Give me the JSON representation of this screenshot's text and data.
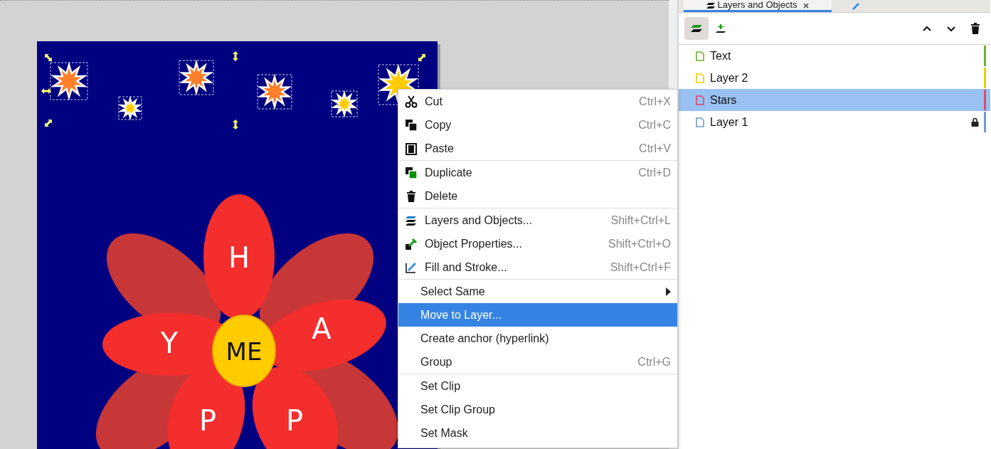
{
  "canvas": {
    "petal_letters": [
      "H",
      "Y",
      "A",
      "P",
      "P"
    ],
    "center_text": "ME"
  },
  "context_menu": {
    "sections": [
      [
        {
          "label": "Cut",
          "shortcut": "Ctrl+X",
          "kind": "icon",
          "selected": false
        },
        {
          "label": "Copy",
          "shortcut": "Ctrl+C",
          "kind": "icon",
          "selected": false
        },
        {
          "label": "Paste",
          "shortcut": "Ctrl+V",
          "kind": "icon",
          "selected": false
        }
      ],
      [
        {
          "label": "Duplicate",
          "shortcut": "Ctrl+D",
          "kind": "icon",
          "selected": false
        },
        {
          "label": "Delete",
          "kind": "icon",
          "selected": false
        }
      ],
      [
        {
          "label": "Layers and Objects...",
          "shortcut": "Shift+Ctrl+L",
          "kind": "icon",
          "selected": false
        },
        {
          "label": "Object Properties...",
          "shortcut": "Shift+Ctrl+O",
          "kind": "icon",
          "selected": false
        },
        {
          "label": "Fill and Stroke...",
          "shortcut": "Shift+Ctrl+F",
          "kind": "icon",
          "selected": false
        }
      ],
      [
        {
          "label": "Select Same",
          "kind": "submenu",
          "selected": false
        },
        {
          "label": "Move to Layer...",
          "kind": "plain",
          "selected": true
        },
        {
          "label": "Create anchor (hyperlink)",
          "kind": "plain",
          "selected": false
        },
        {
          "label": "Group",
          "shortcut": "Ctrl+G",
          "kind": "plain",
          "selected": false
        }
      ],
      [
        {
          "label": "Set Clip",
          "kind": "plain",
          "selected": false
        },
        {
          "label": "Set Clip Group",
          "kind": "plain",
          "selected": false
        },
        {
          "label": "Set Mask",
          "kind": "plain",
          "selected": false
        }
      ]
    ]
  },
  "panel": {
    "tabs": [
      {
        "label": "Layers and Objects",
        "selected": true
      },
      {
        "selected": false
      }
    ],
    "layers_toggle_on": true,
    "layers": [
      {
        "name": "Text",
        "color": "#6ab130",
        "selected": false,
        "locked": false
      },
      {
        "name": "Layer 2",
        "color": "#e6cf00",
        "selected": false,
        "locked": false
      },
      {
        "name": "Stars",
        "color": "#e04a6a",
        "selected": true,
        "locked": false
      },
      {
        "name": "Layer 1",
        "color": "#6f9bd1",
        "selected": false,
        "locked": true
      }
    ]
  }
}
